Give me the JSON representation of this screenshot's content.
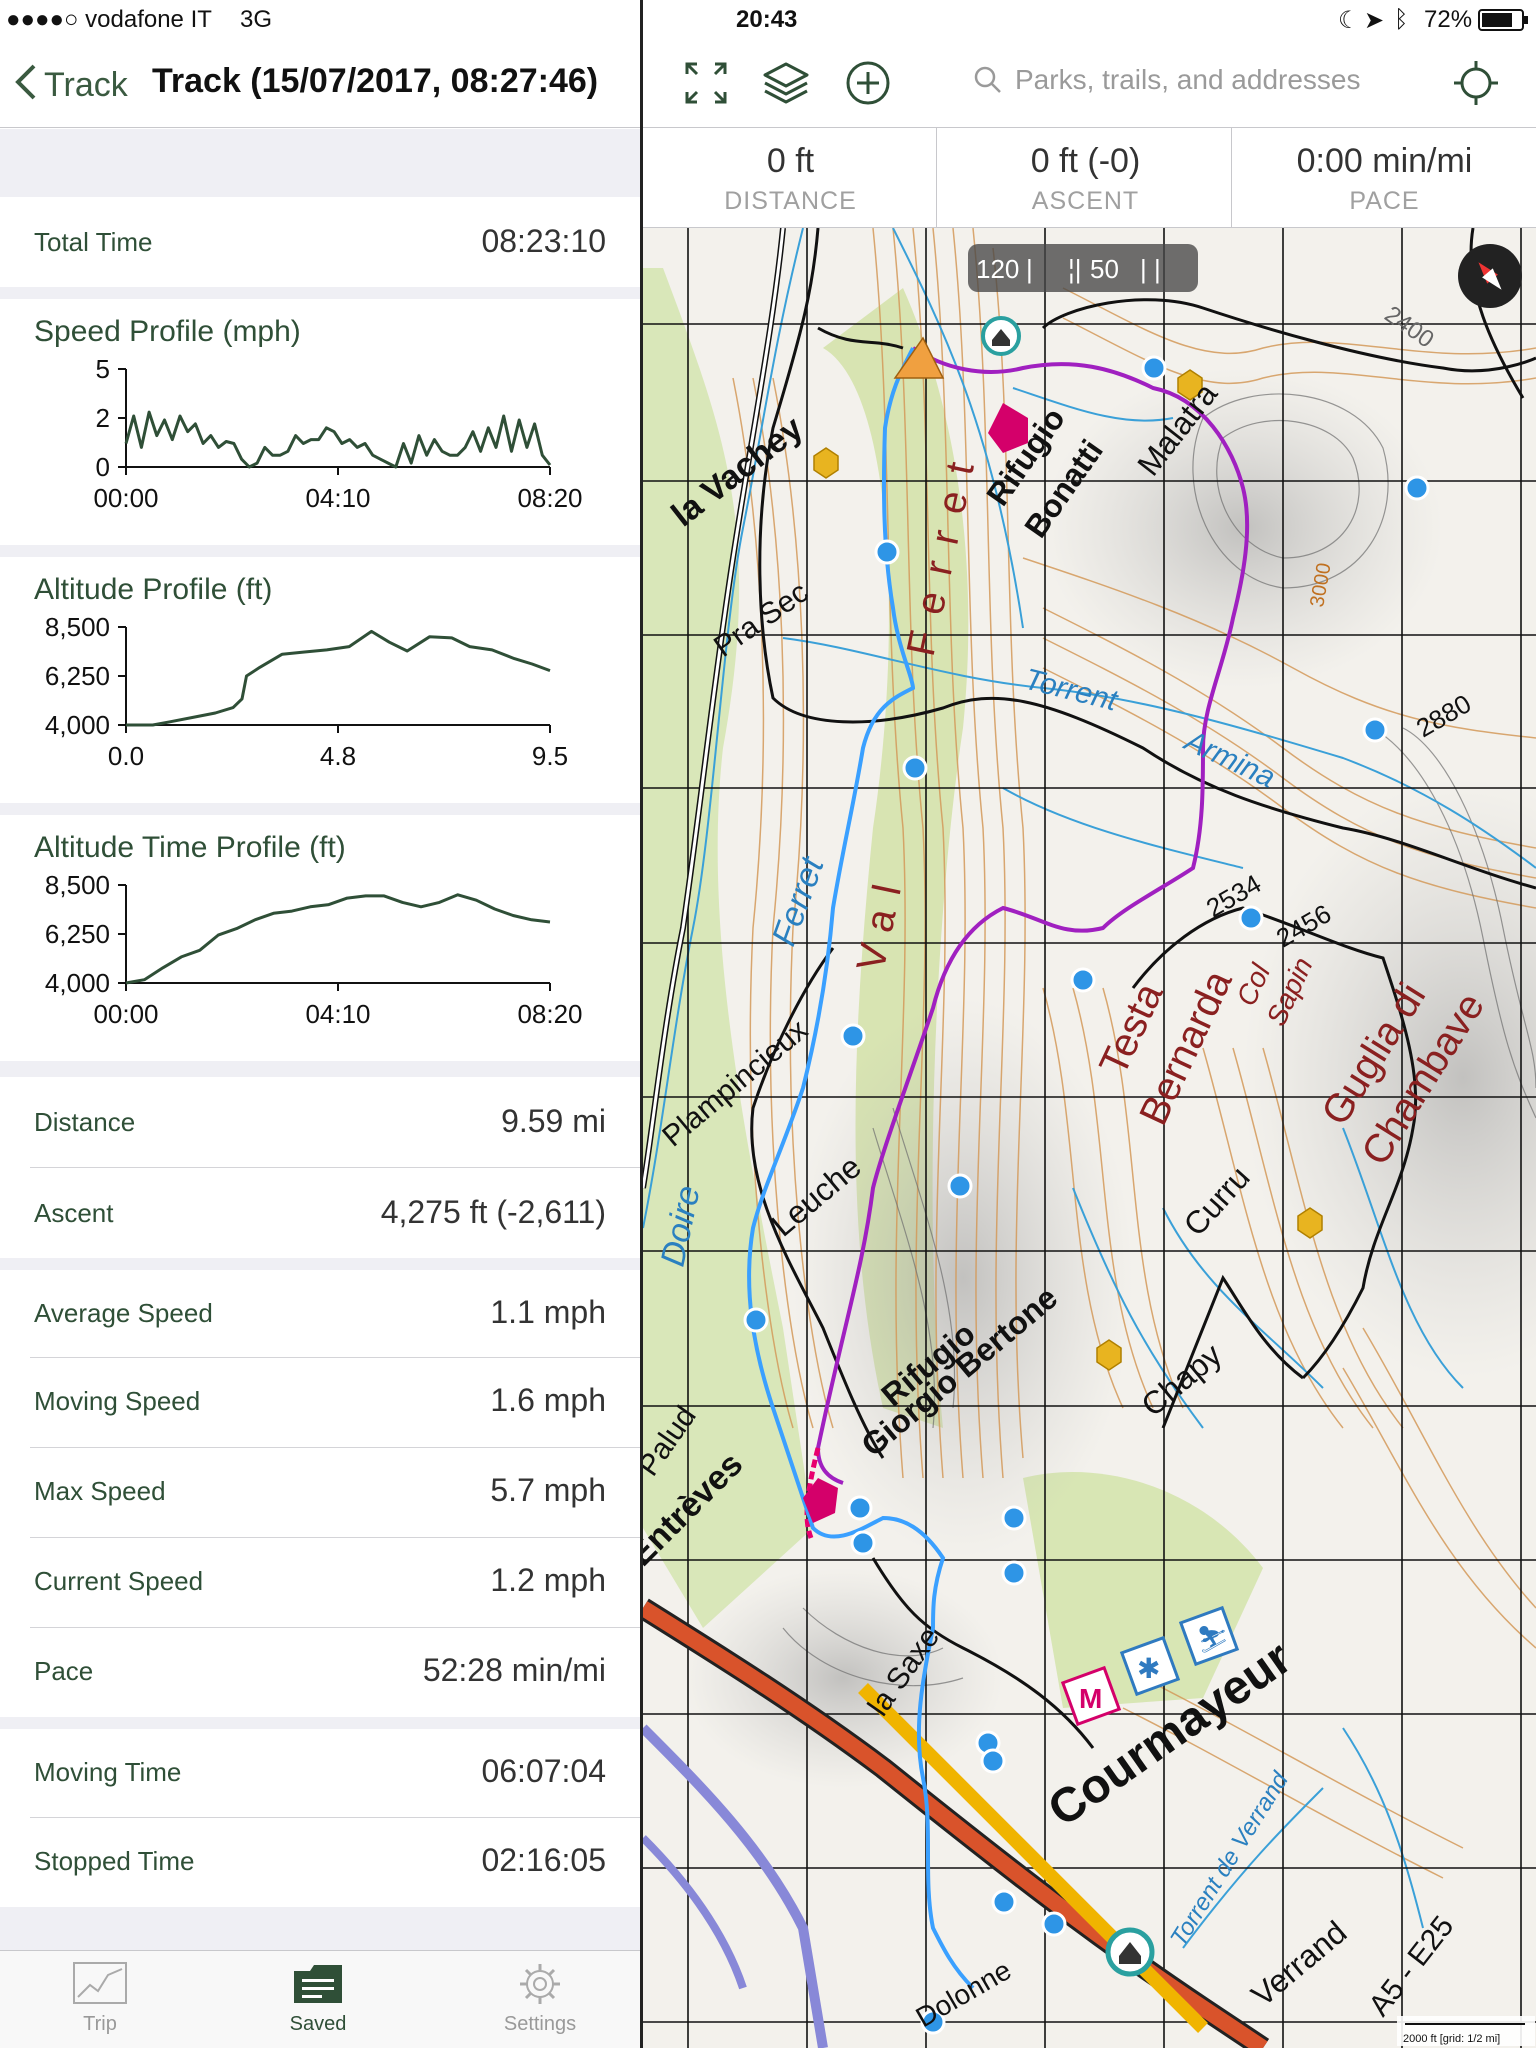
{
  "status_bar": {
    "carrier": "●●●●○ vodafone IT",
    "network": "3G",
    "time": "20:43",
    "battery": "72%"
  },
  "nav": {
    "back_label": "Track",
    "title": "Track (15/07/2017, 08:27:46)"
  },
  "summary": {
    "total_time_label": "Total Time",
    "total_time_value": "08:23:10"
  },
  "charts": {
    "speed": {
      "title": "Speed Profile (mph)"
    },
    "altitude": {
      "title": "Altitude Profile (ft)"
    },
    "altitude_time": {
      "title": "Altitude Time Profile (ft)"
    }
  },
  "chart_data": [
    {
      "type": "line",
      "title": "Speed Profile (mph)",
      "x_ticks": [
        "00:00",
        "04:10",
        "08:20"
      ],
      "y_ticks": [
        "5",
        "2",
        "0"
      ],
      "ylim": [
        0,
        5
      ],
      "series": [
        {
          "values": [
            1.2,
            2.6,
            1.0,
            2.8,
            1.6,
            2.4,
            1.4,
            2.6,
            1.8,
            2.2,
            1.2,
            1.6,
            1.0,
            1.3,
            1.2,
            0.4,
            0.0,
            0.2,
            1.0,
            0.6,
            0.6,
            0.8,
            1.6,
            1.2,
            1.4,
            1.4,
            2.0,
            1.8,
            1.2,
            1.4,
            1.0,
            1.2,
            0.6,
            0.4,
            0.2,
            0.0,
            1.2,
            0.2,
            1.6,
            0.6,
            1.4,
            0.8,
            0.6,
            0.6,
            1.0,
            1.8,
            0.8,
            2.0,
            1.0,
            2.6,
            0.8,
            2.4,
            1.0,
            2.2,
            0.6,
            0.1
          ]
        }
      ]
    },
    {
      "type": "line",
      "title": "Altitude Profile (ft)",
      "x_ticks": [
        "0.0",
        "4.8",
        "9.5"
      ],
      "y_ticks": [
        "8,500",
        "6,250",
        "4,000"
      ],
      "ylim": [
        4000,
        8500
      ],
      "xlim": [
        0,
        9.5
      ],
      "series": [
        {
          "x": [
            0,
            0.6,
            1.0,
            1.5,
            2.0,
            2.4,
            2.6,
            2.7,
            3.0,
            3.5,
            4.0,
            4.5,
            5.0,
            5.5,
            5.9,
            6.3,
            6.8,
            7.3,
            7.7,
            8.2,
            8.7,
            9.1,
            9.5
          ],
          "values": [
            4000,
            4000,
            4150,
            4350,
            4550,
            4800,
            5200,
            6250,
            6650,
            7250,
            7350,
            7450,
            7600,
            8300,
            7800,
            7400,
            8050,
            8000,
            7600,
            7450,
            7050,
            6800,
            6500
          ]
        }
      ]
    },
    {
      "type": "line",
      "title": "Altitude Time Profile (ft)",
      "x_ticks": [
        "00:00",
        "04:10",
        "08:20"
      ],
      "y_ticks": [
        "8,500",
        "6,250",
        "4,000"
      ],
      "ylim": [
        4000,
        8500
      ],
      "series": [
        {
          "values": [
            4000,
            4150,
            4700,
            5200,
            5500,
            6200,
            6500,
            6900,
            7200,
            7300,
            7500,
            7600,
            7900,
            8000,
            8000,
            7700,
            7500,
            7700,
            8050,
            7800,
            7400,
            7100,
            6900,
            6800
          ]
        }
      ]
    }
  ],
  "stats_rows": [
    {
      "label": "Distance",
      "value": "9.59 mi"
    },
    {
      "label": "Ascent",
      "value": "4,275 ft (-2,611)"
    },
    {
      "label": "Average Speed",
      "value": "1.1 mph"
    },
    {
      "label": "Moving Speed",
      "value": "1.6 mph"
    },
    {
      "label": "Max Speed",
      "value": "5.7 mph"
    },
    {
      "label": "Current Speed",
      "value": "1.2 mph"
    },
    {
      "label": "Pace",
      "value": "52:28 min/mi"
    },
    {
      "label": "Moving Time",
      "value": "06:07:04"
    },
    {
      "label": "Stopped Time",
      "value": "02:16:05"
    }
  ],
  "tabs": [
    {
      "label": "Trip",
      "icon": "trip-icon"
    },
    {
      "label": "Saved",
      "icon": "saved-icon"
    },
    {
      "label": "Settings",
      "icon": "gear-icon"
    }
  ],
  "map_toolbar": {
    "search_placeholder": "Parks, trails, and addresses"
  },
  "map_stats": [
    {
      "value": "0 ft",
      "label": "DISTANCE"
    },
    {
      "value": "0 ft (-0)",
      "label": "ASCENT"
    },
    {
      "value": "0:00 min/mi",
      "label": "PACE"
    }
  ],
  "map": {
    "scale_left": "120",
    "scale_right": "50",
    "labels": {
      "la_vachey": "la Vachey",
      "rifugio_bonatti_1": "Rifugio",
      "rifugio_bonatti_2": "Bonatti",
      "malatra": "Malatra",
      "pra_sec": "Pra Sec",
      "torrent_armina": "Torrent",
      "armina": "Armina",
      "val_ferret_1": "Ferret",
      "val_ferret_2": "Val",
      "ferret_2": "Ferret",
      "testa_bernarda_1": "Testa",
      "testa_bernarda_2": "Bernarda",
      "col_sapin_1": "Col",
      "col_sapin_2": "Sapin",
      "plampincieux": "Plampincieux",
      "leuche": "Leuche",
      "curru": "Curru",
      "chapy": "Chapy",
      "rifugio_bertone_1": "Rifugio",
      "rifugio_bertone_2": "Giorgio Bertone",
      "courmayeur": "Courmayeur",
      "la_saxe": "la Saxe",
      "entreves": "Entrèves",
      "palud": "Palud",
      "doire": "Doire",
      "verrand": "Verrand",
      "torrent_verrand": "Torrent de Verrand",
      "guglia_1": "Guglia di",
      "guglia_2": "Chambave",
      "alt_2534": "2534",
      "alt_2456": "2456",
      "alt_2880": "2880",
      "alt_2400": "2400",
      "alt_3000": "3000",
      "road_a5": "A5 - E25",
      "dolonne": "Dolonne",
      "grid_note": "2000 ft [grid: 1/2 mi]"
    }
  }
}
